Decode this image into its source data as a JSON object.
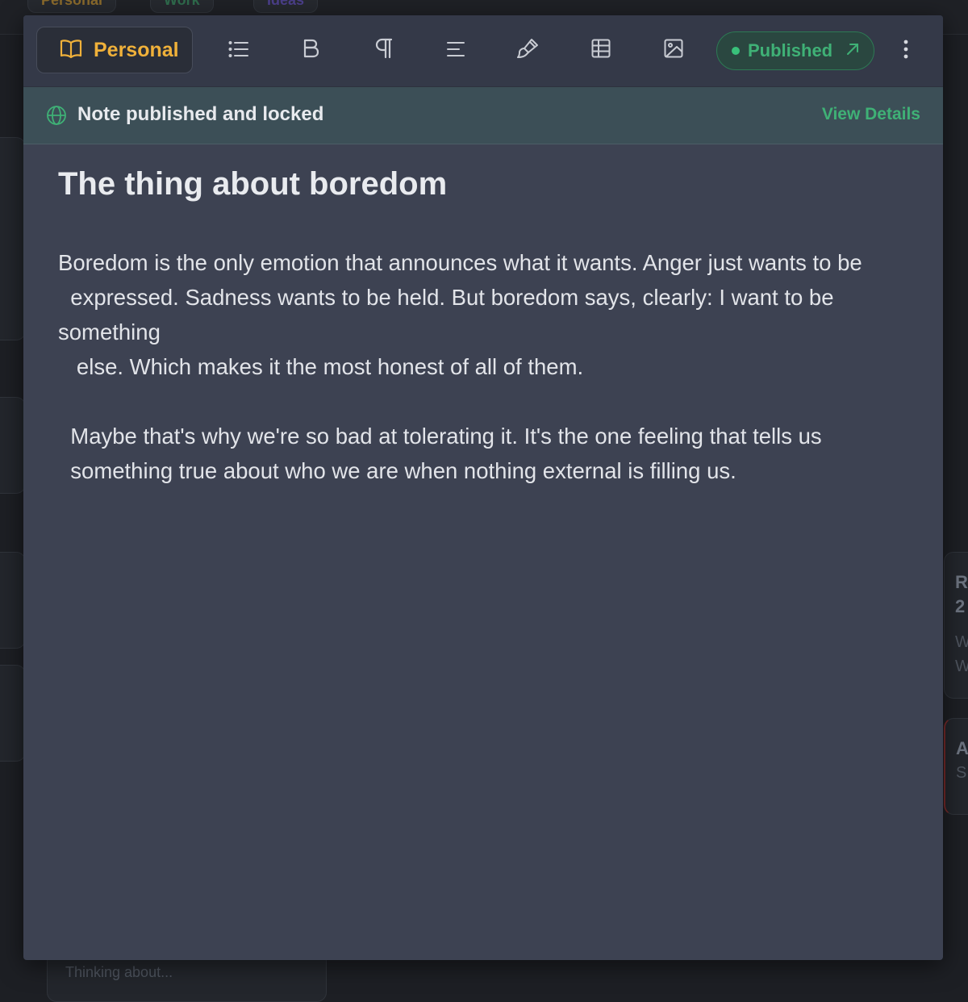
{
  "background": {
    "tabs": [
      "Personal",
      "Work",
      "Ideas"
    ],
    "right_cards": [
      {
        "title": "R",
        "title2": "2",
        "line1": "W",
        "line2": "W"
      },
      {
        "title": "A",
        "line1": "S"
      }
    ],
    "bottom_card_text": "Thinking about..."
  },
  "toolbar": {
    "notebook_label": "Personal",
    "notebook_icon": "book-open-icon",
    "tools": [
      {
        "name": "list-icon"
      },
      {
        "name": "bold-icon"
      },
      {
        "name": "paragraph-icon"
      },
      {
        "name": "align-left-icon"
      },
      {
        "name": "paintbrush-icon"
      },
      {
        "name": "table-icon"
      },
      {
        "name": "image-icon"
      }
    ],
    "published_label": "Published",
    "accent_color": "#f0b13a",
    "published_color": "#3fb176"
  },
  "banner": {
    "message": "Note published and locked",
    "link_label": "View Details"
  },
  "note": {
    "title": "The thing about boredom",
    "body": "Boredom is the only emotion that announces what it wants. Anger just wants to be\n  expressed. Sadness wants to be held. But boredom says, clearly: I want to be something\n   else. Which makes it the most honest of all of them.\n\n  Maybe that's why we're so bad at tolerating it. It's the one feeling that tells us\n  something true about who we are when nothing external is filling us."
  }
}
